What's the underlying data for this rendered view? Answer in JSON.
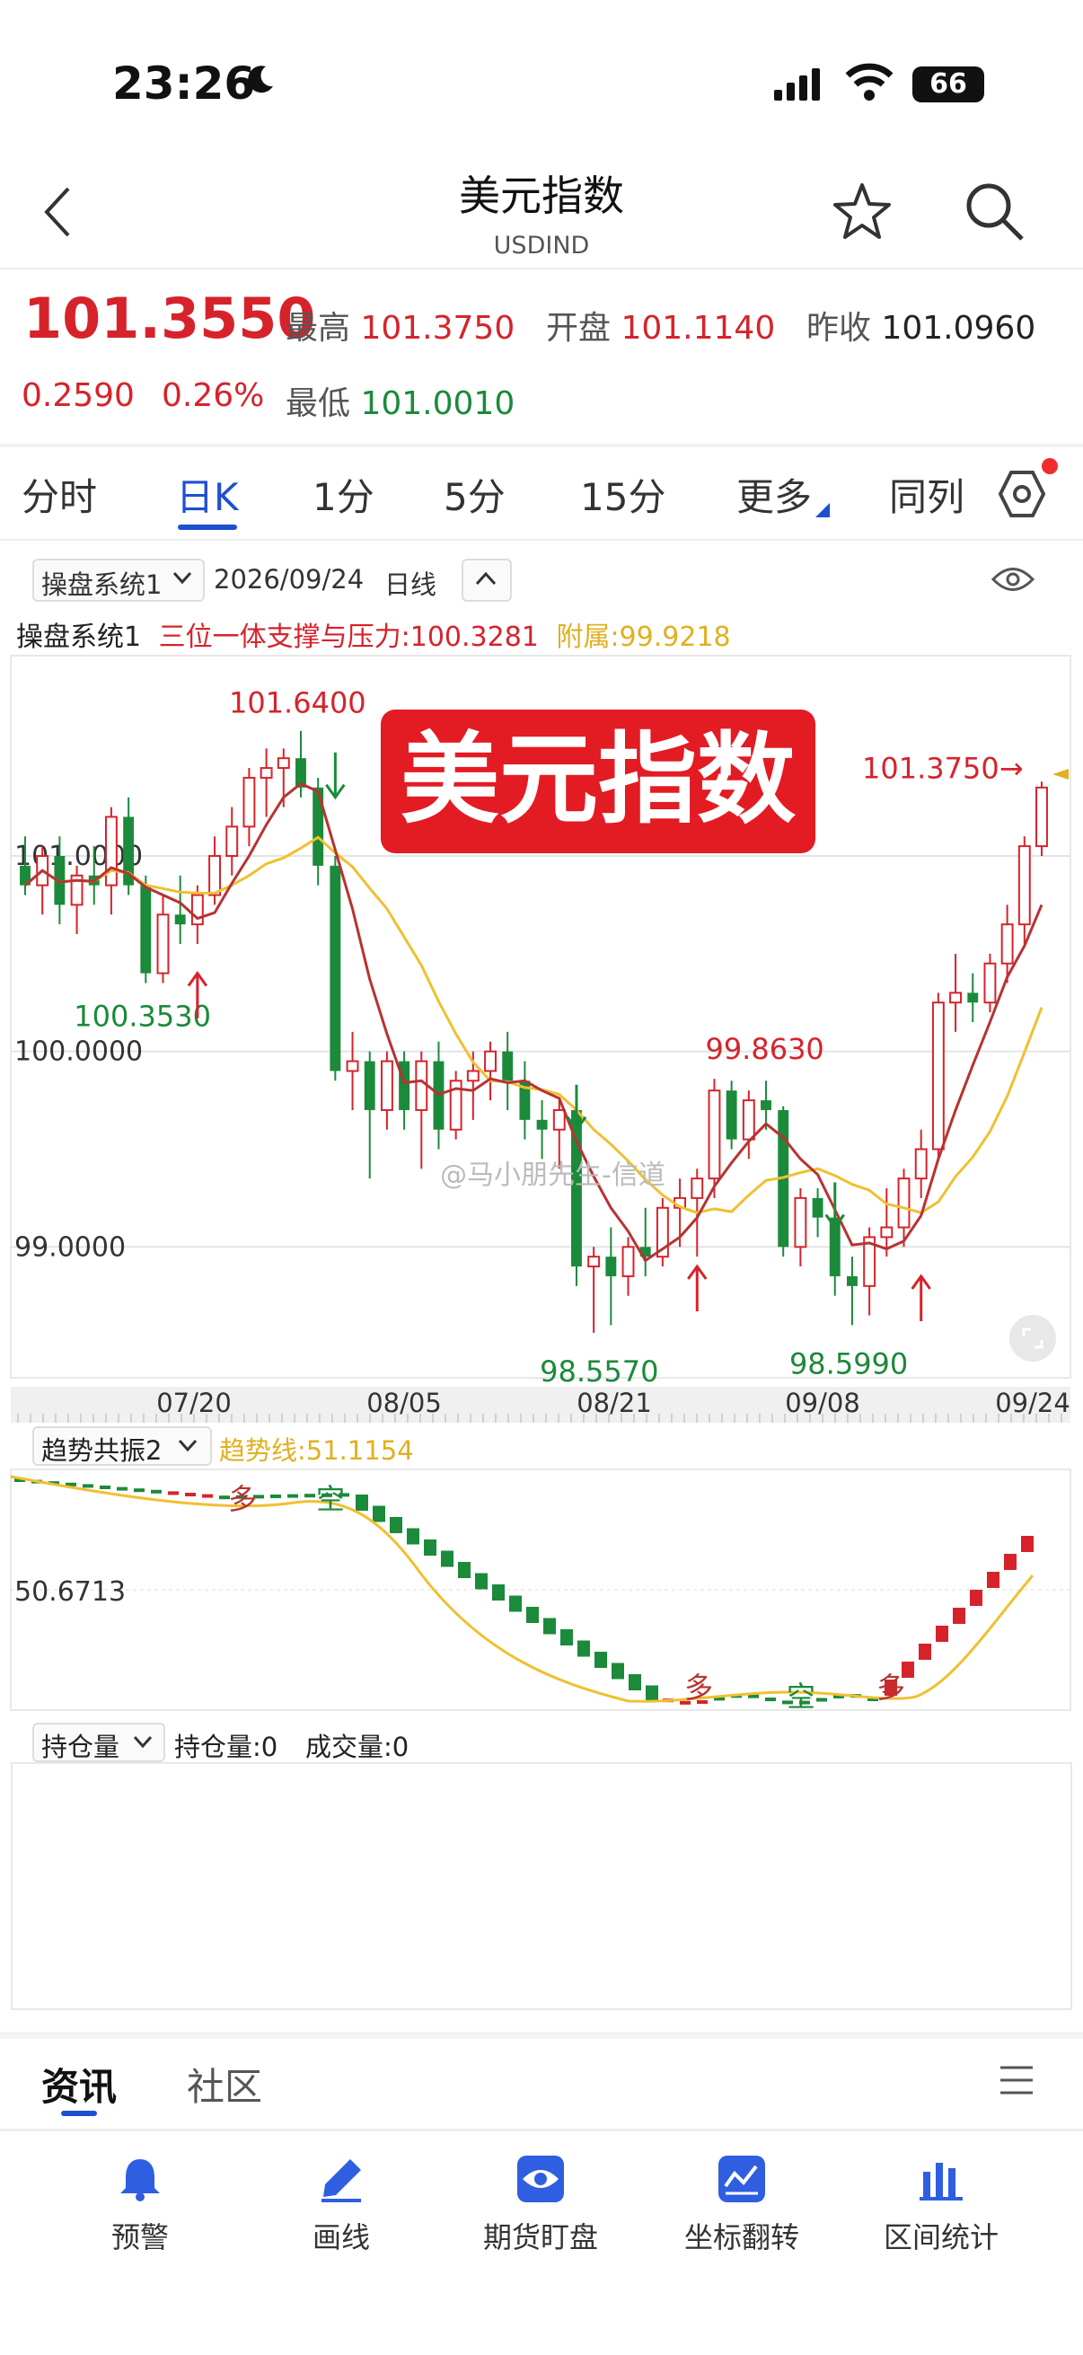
{
  "status_bar": {
    "time": "23:26",
    "battery": "66"
  },
  "header": {
    "title": "美元指数",
    "subtitle": "USDIND"
  },
  "quote": {
    "price": "101.3550",
    "change": "0.2590",
    "change_pct": "0.26%",
    "high_label": "最高",
    "high": "101.3750",
    "open_label": "开盘",
    "open": "101.1140",
    "prev_label": "昨收",
    "prev": "101.0960",
    "low_label": "最低",
    "low": "101.0010"
  },
  "tabs": [
    {
      "label": "分时"
    },
    {
      "label": "日K"
    },
    {
      "label": "1分"
    },
    {
      "label": "5分"
    },
    {
      "label": "15分"
    },
    {
      "label": "更多"
    },
    {
      "label": "同列"
    }
  ],
  "toolbar": {
    "system": "操盘系统1",
    "date": "2026/09/24",
    "period": "日线"
  },
  "indicator": {
    "name": "操盘系统1",
    "sr_text": "三位一体支撑与压力:100.3281",
    "aux_text": "附属:99.9218"
  },
  "chart_data": {
    "type": "candlestick",
    "title": "美元指数",
    "y_ticks": [
      "101.0000",
      "100.0000",
      "99.0000"
    ],
    "x_ticks": [
      "07/20",
      "08/05",
      "08/21",
      "09/08",
      "09/24"
    ],
    "annotations": [
      "101.6400",
      "100.3530",
      "98.5570",
      "99.8630",
      "98.5990",
      "101.3750→"
    ],
    "watermark": "@马小朋先生-信道",
    "candles": [
      {
        "o": 100.95,
        "h": 101.1,
        "l": 100.8,
        "c": 100.85
      },
      {
        "o": 100.85,
        "h": 101.05,
        "l": 100.7,
        "c": 101.0
      },
      {
        "o": 101.0,
        "h": 101.1,
        "l": 100.65,
        "c": 100.75
      },
      {
        "o": 100.75,
        "h": 100.95,
        "l": 100.6,
        "c": 100.9
      },
      {
        "o": 100.9,
        "h": 101.05,
        "l": 100.75,
        "c": 100.85
      },
      {
        "o": 100.85,
        "h": 101.25,
        "l": 100.7,
        "c": 101.2
      },
      {
        "o": 101.2,
        "h": 101.3,
        "l": 100.8,
        "c": 100.85
      },
      {
        "o": 100.85,
        "h": 100.9,
        "l": 100.35,
        "c": 100.4
      },
      {
        "o": 100.4,
        "h": 100.8,
        "l": 100.35,
        "c": 100.7
      },
      {
        "o": 100.7,
        "h": 100.9,
        "l": 100.55,
        "c": 100.65
      },
      {
        "o": 100.65,
        "h": 100.85,
        "l": 100.55,
        "c": 100.8
      },
      {
        "o": 100.8,
        "h": 101.1,
        "l": 100.75,
        "c": 101.0
      },
      {
        "o": 101.0,
        "h": 101.25,
        "l": 100.9,
        "c": 101.15
      },
      {
        "o": 101.15,
        "h": 101.45,
        "l": 101.05,
        "c": 101.4
      },
      {
        "o": 101.4,
        "h": 101.55,
        "l": 101.2,
        "c": 101.45
      },
      {
        "o": 101.45,
        "h": 101.55,
        "l": 101.25,
        "c": 101.5
      },
      {
        "o": 101.5,
        "h": 101.64,
        "l": 101.3,
        "c": 101.35
      },
      {
        "o": 101.35,
        "h": 101.4,
        "l": 100.85,
        "c": 100.95
      },
      {
        "o": 100.95,
        "h": 101.0,
        "l": 99.85,
        "c": 99.9
      },
      {
        "o": 99.9,
        "h": 100.1,
        "l": 99.7,
        "c": 99.95
      },
      {
        "o": 99.95,
        "h": 100.0,
        "l": 99.35,
        "c": 99.7
      },
      {
        "o": 99.7,
        "h": 100.0,
        "l": 99.6,
        "c": 99.95
      },
      {
        "o": 99.95,
        "h": 100.0,
        "l": 99.6,
        "c": 99.7
      },
      {
        "o": 99.7,
        "h": 100.0,
        "l": 99.4,
        "c": 99.95
      },
      {
        "o": 99.95,
        "h": 100.05,
        "l": 99.5,
        "c": 99.6
      },
      {
        "o": 99.6,
        "h": 99.9,
        "l": 99.55,
        "c": 99.85
      },
      {
        "o": 99.85,
        "h": 100.0,
        "l": 99.65,
        "c": 99.9
      },
      {
        "o": 99.9,
        "h": 100.05,
        "l": 99.75,
        "c": 100.0
      },
      {
        "o": 100.0,
        "h": 100.1,
        "l": 99.7,
        "c": 99.85
      },
      {
        "o": 99.85,
        "h": 99.95,
        "l": 99.55,
        "c": 99.65
      },
      {
        "o": 99.65,
        "h": 99.75,
        "l": 99.45,
        "c": 99.6
      },
      {
        "o": 99.6,
        "h": 99.75,
        "l": 99.4,
        "c": 99.7
      },
      {
        "o": 99.7,
        "h": 99.75,
        "l": 98.8,
        "c": 98.9
      },
      {
        "o": 98.9,
        "h": 99.0,
        "l": 98.56,
        "c": 98.95
      },
      {
        "o": 98.95,
        "h": 99.1,
        "l": 98.6,
        "c": 98.85
      },
      {
        "o": 98.85,
        "h": 99.05,
        "l": 98.75,
        "c": 99.0
      },
      {
        "o": 99.0,
        "h": 99.2,
        "l": 98.85,
        "c": 98.95
      },
      {
        "o": 98.95,
        "h": 99.25,
        "l": 98.9,
        "c": 99.2
      },
      {
        "o": 99.2,
        "h": 99.35,
        "l": 99.0,
        "c": 99.25
      },
      {
        "o": 99.25,
        "h": 99.4,
        "l": 98.95,
        "c": 99.35
      },
      {
        "o": 99.35,
        "h": 99.86,
        "l": 99.25,
        "c": 99.8
      },
      {
        "o": 99.8,
        "h": 99.85,
        "l": 99.5,
        "c": 99.55
      },
      {
        "o": 99.55,
        "h": 99.8,
        "l": 99.45,
        "c": 99.75
      },
      {
        "o": 99.75,
        "h": 99.85,
        "l": 99.6,
        "c": 99.7
      },
      {
        "o": 99.7,
        "h": 99.72,
        "l": 98.95,
        "c": 99.0
      },
      {
        "o": 99.0,
        "h": 99.3,
        "l": 98.9,
        "c": 99.25
      },
      {
        "o": 99.25,
        "h": 99.3,
        "l": 99.05,
        "c": 99.15
      },
      {
        "o": 99.15,
        "h": 99.25,
        "l": 98.75,
        "c": 98.85
      },
      {
        "o": 98.85,
        "h": 98.95,
        "l": 98.6,
        "c": 98.8
      },
      {
        "o": 98.8,
        "h": 99.1,
        "l": 98.65,
        "c": 99.05
      },
      {
        "o": 99.05,
        "h": 99.3,
        "l": 98.95,
        "c": 99.1
      },
      {
        "o": 99.1,
        "h": 99.4,
        "l": 99.0,
        "c": 99.35
      },
      {
        "o": 99.35,
        "h": 99.6,
        "l": 99.25,
        "c": 99.5
      },
      {
        "o": 99.5,
        "h": 100.3,
        "l": 99.45,
        "c": 100.25
      },
      {
        "o": 100.25,
        "h": 100.5,
        "l": 100.1,
        "c": 100.3
      },
      {
        "o": 100.3,
        "h": 100.4,
        "l": 100.15,
        "c": 100.25
      },
      {
        "o": 100.25,
        "h": 100.5,
        "l": 100.2,
        "c": 100.45
      },
      {
        "o": 100.45,
        "h": 100.75,
        "l": 100.35,
        "c": 100.65
      },
      {
        "o": 100.65,
        "h": 101.1,
        "l": 100.55,
        "c": 101.05
      },
      {
        "o": 101.05,
        "h": 101.38,
        "l": 101.0,
        "c": 101.35
      }
    ]
  },
  "trend_panel": {
    "name": "趋势共振2",
    "trend_line": "趋势线:51.1154",
    "y_tick": "50.6713",
    "labels": [
      "多",
      "空",
      "多",
      "空",
      "多"
    ]
  },
  "oi_panel": {
    "name": "持仓量",
    "oi": "持仓量:0",
    "volume": "成交量:0"
  },
  "news_tabs": [
    {
      "label": "资讯"
    },
    {
      "label": "社区"
    }
  ],
  "bottom_nav": [
    {
      "label": "预警",
      "icon": "bell-icon"
    },
    {
      "label": "画线",
      "icon": "pen-icon"
    },
    {
      "label": "期货盯盘",
      "icon": "eye-icon"
    },
    {
      "label": "坐标翻转",
      "icon": "flip-icon"
    },
    {
      "label": "区间统计",
      "icon": "stats-icon"
    }
  ],
  "colors": {
    "up": "#d6232b",
    "down": "#1b8a3a",
    "accent": "#1f4fd1",
    "ma_slow": "#f0c030",
    "ma_fast": "#b83232"
  }
}
